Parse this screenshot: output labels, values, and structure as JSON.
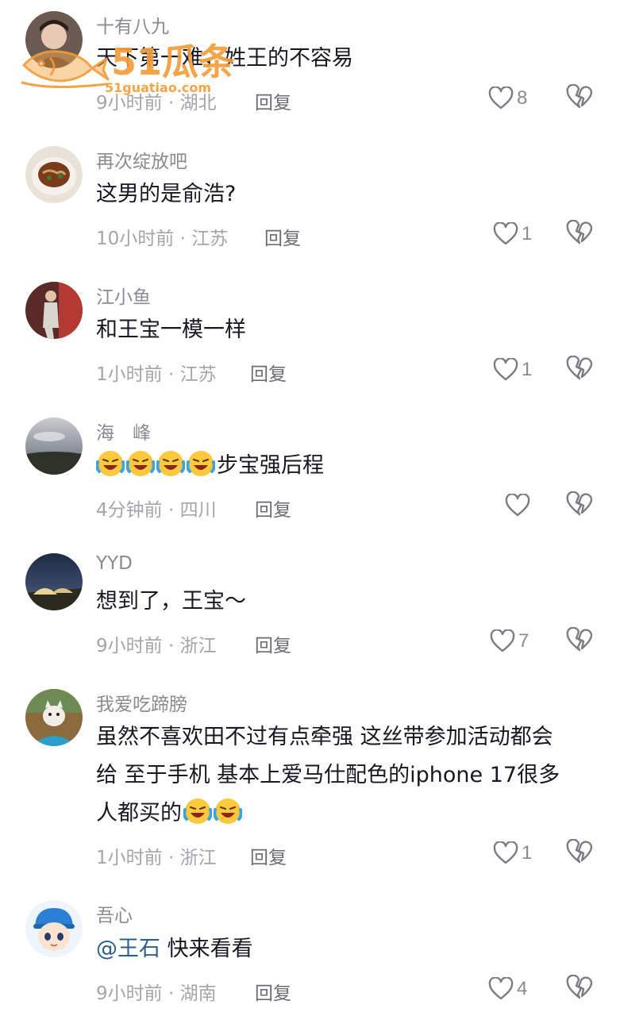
{
  "watermark": {
    "brand": "51瓜条",
    "site": "51guatiao.com",
    "color": "#f39c3a"
  },
  "comments": [
    {
      "username": "十有八九",
      "text": "天下第一难，姓王的不容易",
      "time": "9小时前",
      "location": "湖北",
      "reply": "回复",
      "likes": "8"
    },
    {
      "username": "再次绽放吧",
      "text": "这男的是俞浩?",
      "time": "10小时前",
      "location": "江苏",
      "reply": "回复",
      "likes": "1"
    },
    {
      "username": "江小鱼",
      "text": "和王宝一模一样",
      "time": "1小时前",
      "location": "江苏",
      "reply": "回复",
      "likes": "1"
    },
    {
      "username": "海　峰",
      "text": "步宝强后程",
      "emoji_count": 4,
      "time": "4分钟前",
      "location": "四川",
      "reply": "回复",
      "likes": ""
    },
    {
      "username": "YYD",
      "text": "想到了，王宝～",
      "time": "9小时前",
      "location": "浙江",
      "reply": "回复",
      "likes": "7"
    },
    {
      "username": "我爱吃蹄膀",
      "lines": [
        "虽然不喜欢田不过有点牵强 这丝带参加活动都会",
        "给 至于手机 基本上爱马仕配色的iphone 17很多",
        "人都买的"
      ],
      "time": "1小时前",
      "location": "浙江",
      "reply": "回复",
      "likes": "1"
    },
    {
      "username": "吾心",
      "mention": "@王石",
      "text": " 快来看看",
      "time": "9小时前",
      "location": "湖南",
      "reply": "回复",
      "likes": "4"
    }
  ]
}
